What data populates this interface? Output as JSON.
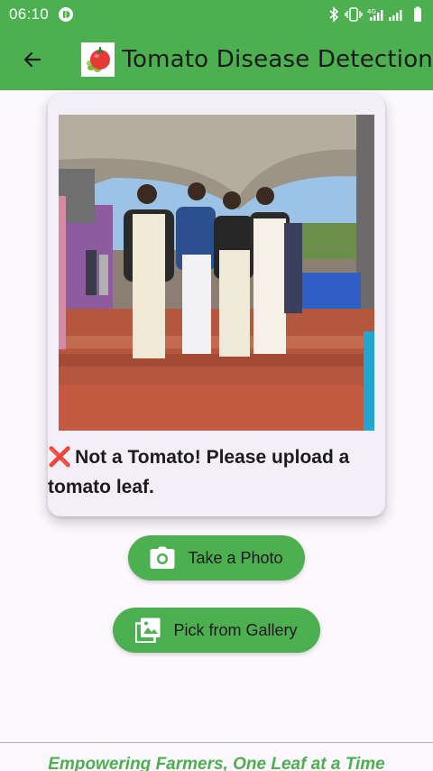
{
  "status_bar": {
    "time": "06:10",
    "network": "4G"
  },
  "app_bar": {
    "title": "Tomato Disease Detection"
  },
  "result": {
    "message": "Not a Tomato! Please upload a tomato leaf."
  },
  "buttons": {
    "take_photo": "Take a Photo",
    "pick_gallery": "Pick from Gallery"
  },
  "footer": {
    "tagline": "Empowering Farmers, One Leaf at a Time"
  },
  "colors": {
    "primary": "#4caf50",
    "background": "#fdf7fe",
    "card": "#f4eef6",
    "error": "#d32f2f"
  }
}
